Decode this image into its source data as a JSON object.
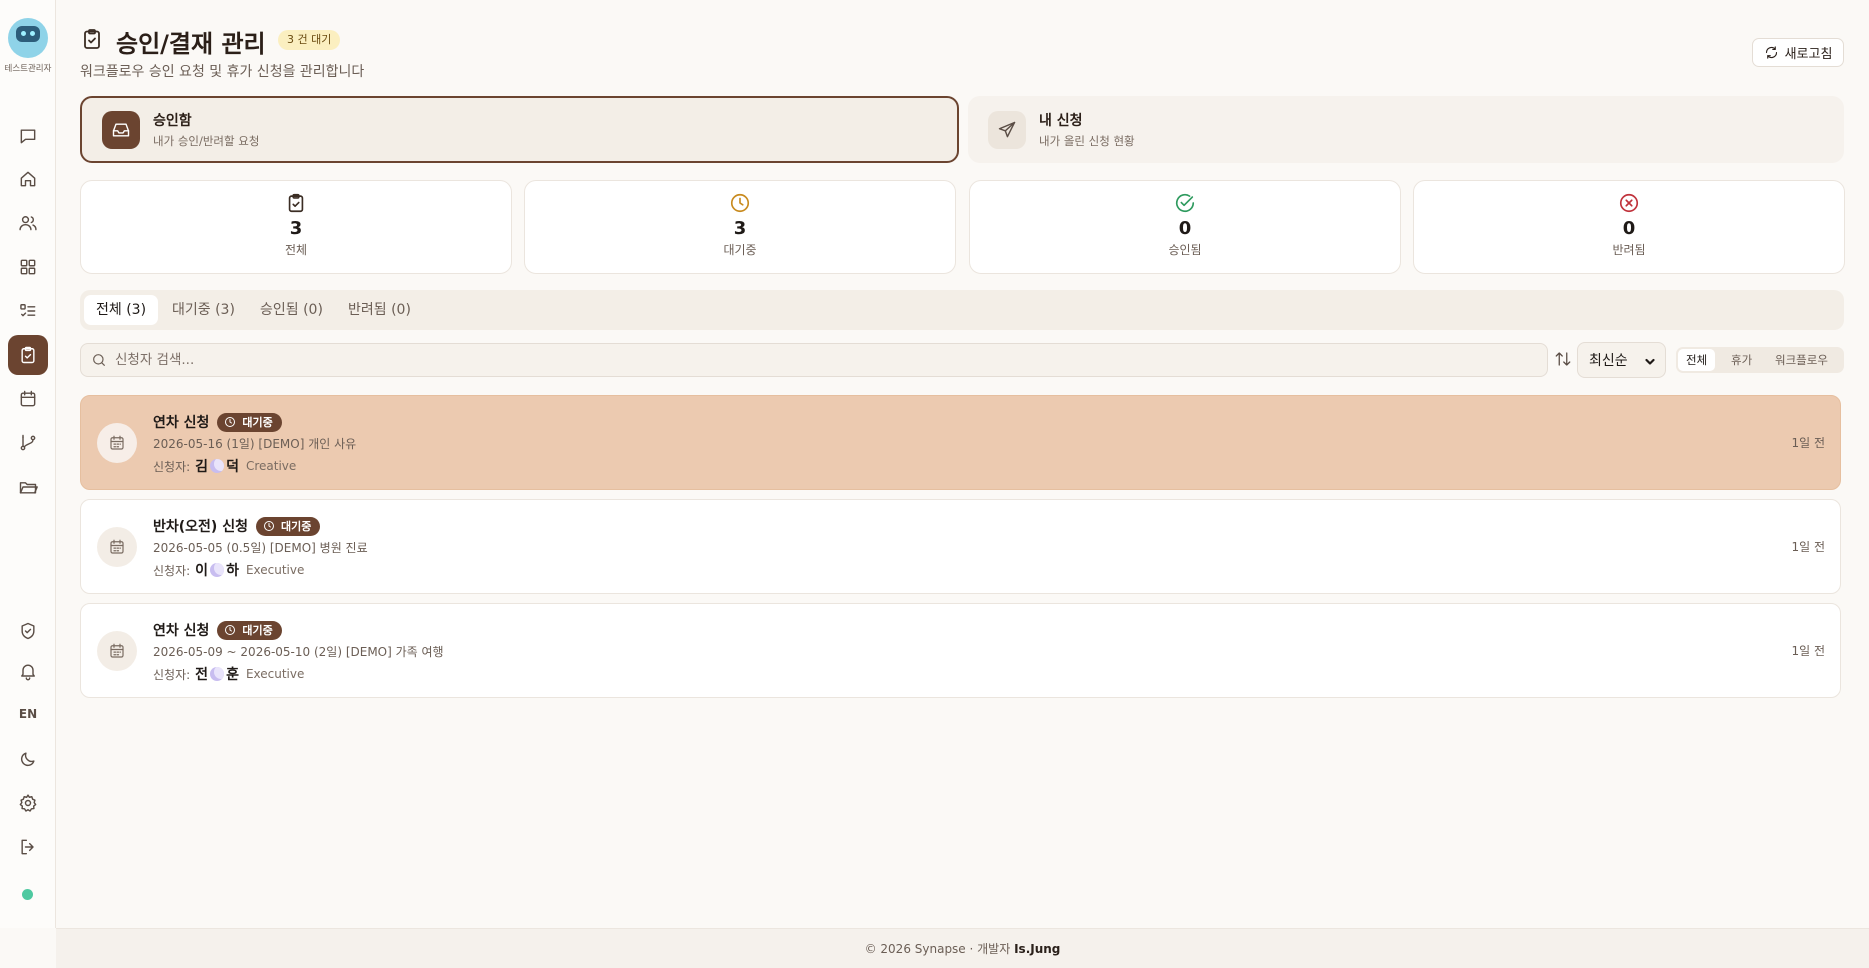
{
  "sidebar": {
    "user_name": "테스트관리자",
    "lang": "EN",
    "nav": [
      "chat",
      "home",
      "users",
      "apps",
      "tasks",
      "approvals",
      "calendar",
      "workflow",
      "files"
    ],
    "bottom": [
      "shield",
      "bell",
      "lang",
      "moon",
      "settings",
      "logout"
    ]
  },
  "header": {
    "title": "승인/결재 관리",
    "pending_badge": "3 건 대기",
    "subtitle": "워크플로우 승인 요청 및 휴가 신청을 관리합니다",
    "refresh_label": "새로고침"
  },
  "modes": {
    "inbox": {
      "title": "승인함",
      "desc": "내가 승인/반려할 요청"
    },
    "mine": {
      "title": "내 신청",
      "desc": "내가 올린 신청 현황"
    }
  },
  "stats": [
    {
      "value": "3",
      "label": "전체",
      "color": "#3b2d24"
    },
    {
      "value": "3",
      "label": "대기중",
      "color": "#c88a1e"
    },
    {
      "value": "0",
      "label": "승인됨",
      "color": "#2e9a5e"
    },
    {
      "value": "0",
      "label": "반려됨",
      "color": "#c0323b"
    }
  ],
  "tabs": [
    "전체 (3)",
    "대기중 (3)",
    "승인됨 (0)",
    "반려됨 (0)"
  ],
  "search": {
    "placeholder": "신청자 검색..."
  },
  "sort": {
    "selected": "최신순"
  },
  "type_filter": [
    "전체",
    "휴가",
    "워크플로우"
  ],
  "items": [
    {
      "title": "연차 신청",
      "status": "대기중",
      "detail": "2026-05-16 (1일)  [DEMO] 개인 사유",
      "applicant_label": "신청자:",
      "name_first": "김",
      "name_last": "덕",
      "dept": "Creative",
      "time": "1일 전"
    },
    {
      "title": "반차(오전) 신청",
      "status": "대기중",
      "detail": "2026-05-05 (0.5일)  [DEMO] 병원 진료",
      "applicant_label": "신청자:",
      "name_first": "이",
      "name_last": "하",
      "dept": "Executive",
      "time": "1일 전"
    },
    {
      "title": "연차 신청",
      "status": "대기중",
      "detail": "2026-05-09 ~ 2026-05-10 (2일)  [DEMO] 가족 여행",
      "applicant_label": "신청자:",
      "name_first": "전",
      "name_last": "훈",
      "dept": "Executive",
      "time": "1일 전"
    }
  ],
  "footer": {
    "text": "© 2026 Synapse · 개발자",
    "developer": "Is.Jung"
  },
  "colors": {
    "accent": "#6b4430",
    "selected_row": "#eccab0",
    "badge_bg": "#fbefc0"
  }
}
